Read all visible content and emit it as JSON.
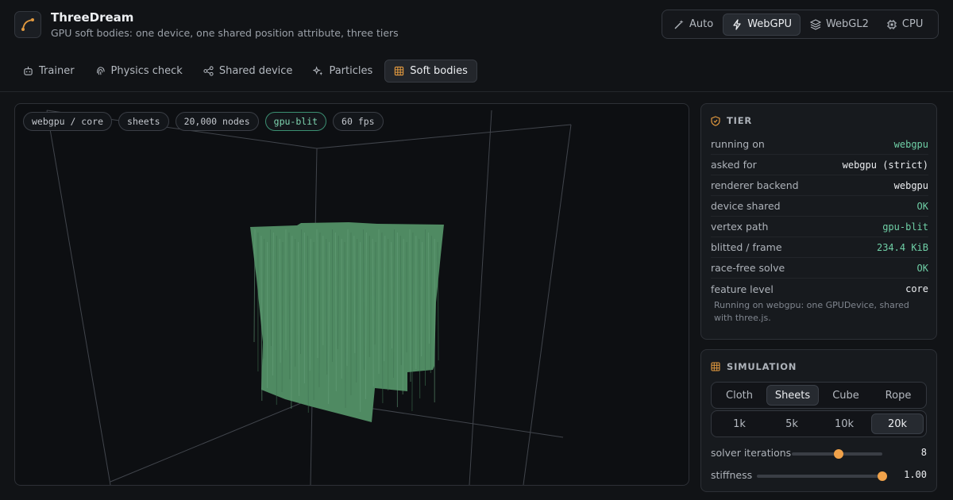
{
  "app": {
    "title": "ThreeDream",
    "subtitle": "GPU soft bodies: one device, one shared position attribute, three tiers"
  },
  "backends": [
    {
      "label": "Auto",
      "icon": "wand-icon",
      "active": false
    },
    {
      "label": "WebGPU",
      "icon": "lightning-icon",
      "active": true
    },
    {
      "label": "WebGL2",
      "icon": "layers-icon",
      "active": false
    },
    {
      "label": "CPU",
      "icon": "chip-icon",
      "active": false
    }
  ],
  "tabs": [
    {
      "label": "Trainer",
      "icon": "robot-icon",
      "active": false
    },
    {
      "label": "Physics check",
      "icon": "fingerprint-icon",
      "active": false
    },
    {
      "label": "Shared device",
      "icon": "share-icon",
      "active": false
    },
    {
      "label": "Particles",
      "icon": "sparkles-icon",
      "active": false
    },
    {
      "label": "Soft bodies",
      "icon": "grid-icon",
      "active": true
    }
  ],
  "viewport": {
    "chips": [
      "webgpu / core",
      "sheets",
      "20,000 nodes",
      "gpu-blit",
      "60 fps"
    ],
    "accent_chip_index": 3,
    "cloth_color": "#4f8a62"
  },
  "tier": {
    "heading": "TIER",
    "rows": [
      {
        "k": "running on",
        "v": "webgpu",
        "green": true
      },
      {
        "k": "asked for",
        "v": "webgpu (strict)",
        "green": false
      },
      {
        "k": "renderer backend",
        "v": "webgpu",
        "green": false
      },
      {
        "k": "device shared",
        "v": "OK",
        "green": true
      },
      {
        "k": "vertex path",
        "v": "gpu-blit",
        "green": true
      },
      {
        "k": "blitted / frame",
        "v": "234.4 KiB",
        "green": true
      },
      {
        "k": "race-free solve",
        "v": "OK",
        "green": true
      },
      {
        "k": "feature level",
        "v": "core",
        "green": false
      }
    ],
    "note": "Running on webgpu: one GPUDevice, shared with three.js."
  },
  "simulation": {
    "heading": "SIMULATION",
    "modes": [
      "Cloth",
      "Sheets",
      "Cube",
      "Rope"
    ],
    "active_mode": "Sheets",
    "counts": [
      "1k",
      "5k",
      "10k",
      "20k"
    ],
    "active_count": "20k",
    "sliders": [
      {
        "label": "solver iterations",
        "value": "8",
        "fraction": 0.52
      },
      {
        "label": "stiffness",
        "value": "1.00",
        "fraction": 1.0
      }
    ]
  },
  "colors": {
    "accent_green": "#6fcfa6",
    "accent_orange": "#f0a24a",
    "background": "#111316"
  }
}
